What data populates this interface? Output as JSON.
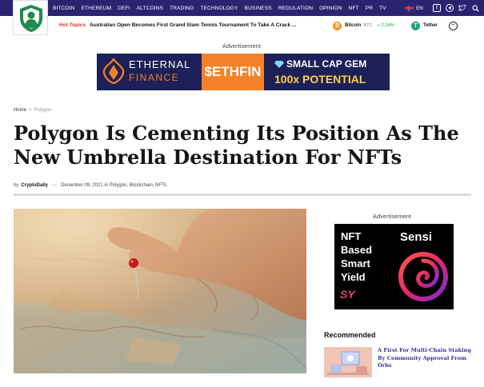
{
  "nav": {
    "menu": [
      "BITCOIN",
      "ETHEREUM",
      "DEFI",
      "ALTCOINS",
      "TRADING",
      "TECHNOLOGY",
      "BUSINESS",
      "REGULATION",
      "OPINION",
      "NFT",
      "PR",
      "TV"
    ],
    "language": "EN",
    "social_icons": [
      "facebook-icon",
      "telegram-icon",
      "twitter-icon",
      "search-icon"
    ],
    "bg_color": "#2a2470"
  },
  "hot_topics": {
    "label": "Hot Topics",
    "headline": "Australian Open Becomes First Grand Slam Tennis Tournament To Take A Crack ..."
  },
  "ticker": {
    "btc_name": "Bitcoin",
    "btc_symbol": "BTC",
    "btc_change": "+ 2.24%",
    "usdt_name": "Tether"
  },
  "top_ad": {
    "label": "Advertisement",
    "brand_line1": "ETHERNAL",
    "brand_line2": "FINANCE",
    "token": "$ETHFIN",
    "tagline1": "SMALL CAP GEM",
    "tagline2": "100x POTENTIAL"
  },
  "breadcrumb": {
    "home": "Home",
    "sep": ">",
    "current": "Polygon"
  },
  "article": {
    "title": "Polygon Is Cementing Its Position As The New Umbrella Destination For NFTs",
    "by": "by",
    "author": "CryptoDaily",
    "dash": "—",
    "date": "December 09, 2021",
    "in": "in",
    "categories": "Polygon, Blockchain, NFTs"
  },
  "side_ad": {
    "label": "Advertisement",
    "lines": [
      "NFT",
      "Based",
      "Smart",
      "Yield"
    ],
    "badge": "SY",
    "brand": "Sensi"
  },
  "recommended": {
    "title": "Recommended",
    "item": "A First For Multi-Chain Staking By Community Approval From Orbs"
  }
}
